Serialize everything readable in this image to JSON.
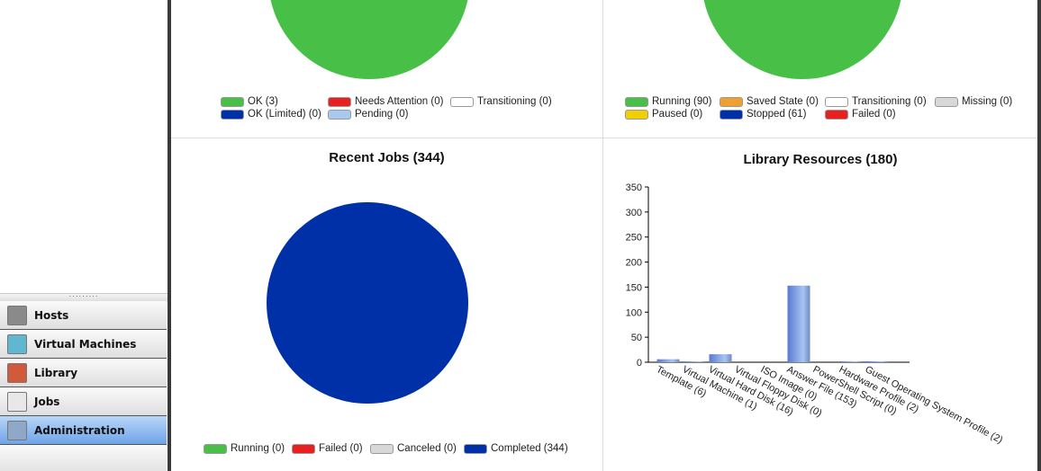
{
  "sidebar": {
    "grip": "·········",
    "items": [
      {
        "label": "Hosts",
        "icon": "server-icon",
        "color": "#8a8a8a"
      },
      {
        "label": "Virtual Machines",
        "icon": "virtual-machines-icon",
        "color": "#5fb8d0"
      },
      {
        "label": "Library",
        "icon": "books-icon",
        "color": "#d05a3a"
      },
      {
        "label": "Jobs",
        "icon": "clipboard-icon",
        "color": "#e8e8e8"
      },
      {
        "label": "Administration",
        "icon": "tools-icon",
        "color": "#90a8c8",
        "selected": true
      }
    ]
  },
  "host_status": {
    "legend": [
      {
        "label": "OK (3)",
        "color": "#48c048"
      },
      {
        "label": "Needs Attention (0)",
        "color": "#e82020"
      },
      {
        "label": "Transitioning (0)",
        "color": "#ffffff"
      },
      {
        "label": "OK (Limited) (0)",
        "color": "#0030a8"
      },
      {
        "label": "Pending (0)",
        "color": "#a8c8f0"
      }
    ]
  },
  "vm_status": {
    "legend": [
      {
        "label": "Running (90)",
        "color": "#48c048"
      },
      {
        "label": "Saved State (0)",
        "color": "#f0a030"
      },
      {
        "label": "Transitioning (0)",
        "color": "#ffffff"
      },
      {
        "label": "Missing (0)",
        "color": "#d8d8d8"
      },
      {
        "label": "Paused (0)",
        "color": "#f0d000"
      },
      {
        "label": "Stopped (61)",
        "color": "#0030a8"
      },
      {
        "label": "Failed (0)",
        "color": "#e82020"
      }
    ]
  },
  "recent_jobs": {
    "title": "Recent Jobs (344)",
    "legend": [
      {
        "label": "Running (0)",
        "color": "#48c048"
      },
      {
        "label": "Failed (0)",
        "color": "#e82020"
      },
      {
        "label": "Canceled (0)",
        "color": "#d8d8d8"
      },
      {
        "label": "Completed (344)",
        "color": "#0030a8"
      }
    ]
  },
  "chart_data": {
    "type": "bar",
    "title": "Library Resources (180)",
    "categories": [
      "Template (6)",
      "Virtual Machine (1)",
      "Virtual Hard Disk (16)",
      "Virtual Floppy Disk (0)",
      "ISO Image (0)",
      "Answer File (153)",
      "PowerShell Script (0)",
      "Hardware Profile (2)",
      "Guest Operating System Profile (2)"
    ],
    "values": [
      6,
      1,
      16,
      0,
      0,
      153,
      0,
      2,
      2
    ],
    "ylim": [
      0,
      350
    ],
    "yticks": [
      0,
      50,
      100,
      150,
      200,
      250,
      300,
      350
    ],
    "bar_color": "#6f90e0",
    "grid": false
  }
}
